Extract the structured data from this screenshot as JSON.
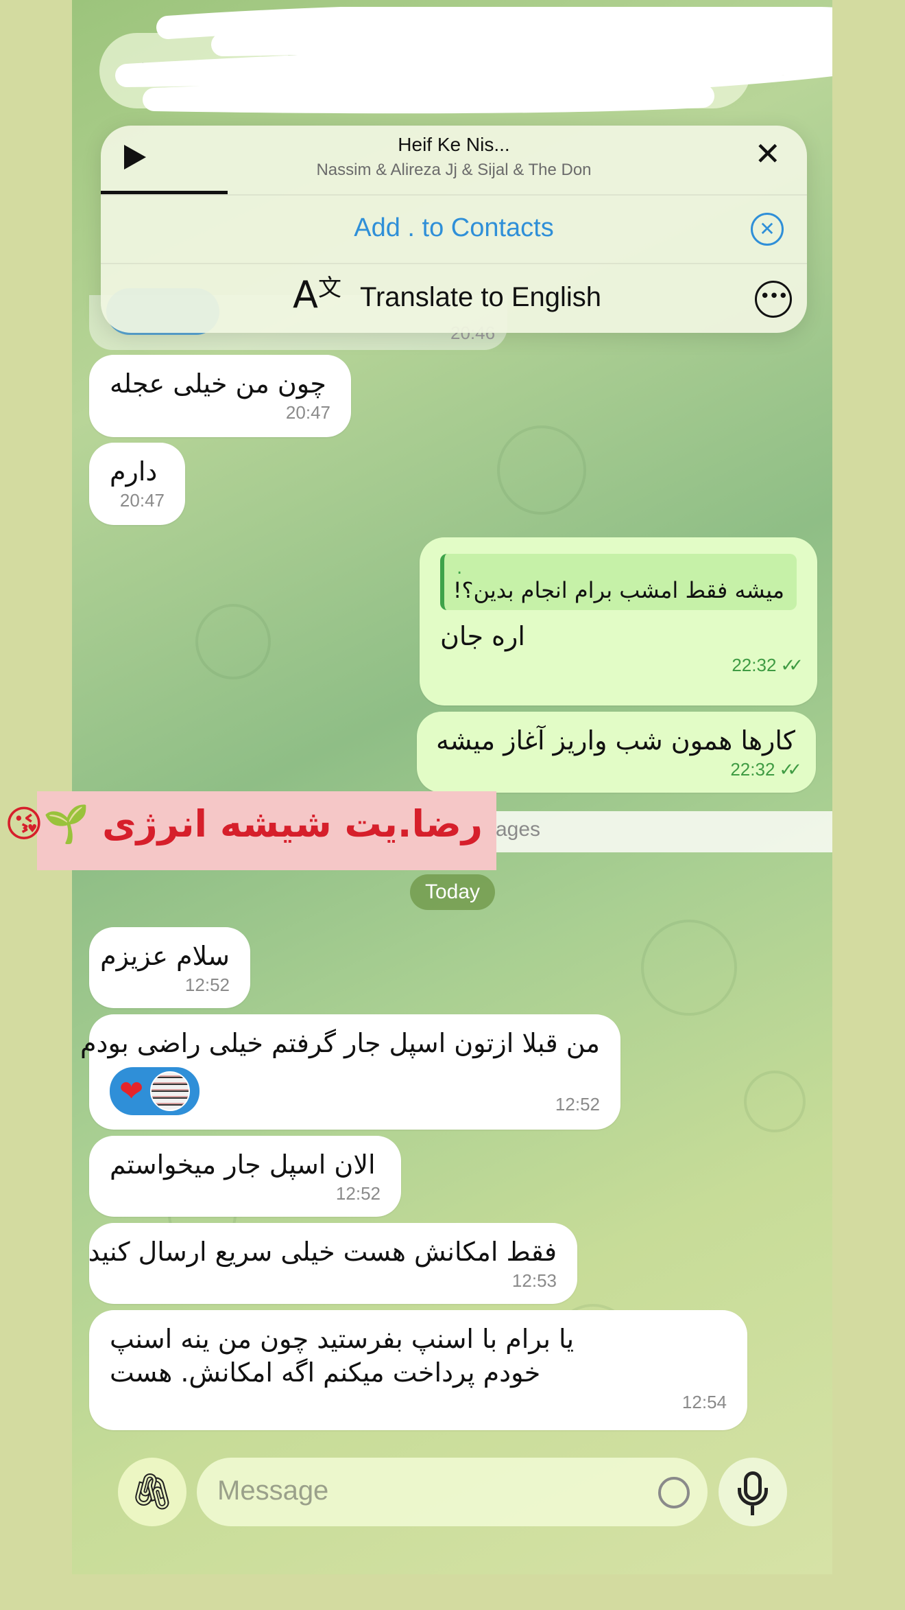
{
  "header": {
    "back_icon": "chevron-left-icon"
  },
  "player": {
    "title": "Heif Ke Nis...",
    "artist": "Nassim & Alireza Jj & Sijal & The Don",
    "progress": 0.18
  },
  "contact_banner": {
    "add_label": "Add . to Contacts"
  },
  "translate_banner": {
    "label": "Translate to English"
  },
  "hidden_message": {
    "time": "20:46"
  },
  "messages": [
    {
      "text": "چون من خیلی عجله",
      "time": "20:47"
    },
    {
      "text": "دارم",
      "time": "20:47"
    },
    {
      "reply_author": ".",
      "reply_text": "میشه فقط امشب برام انجام بدین؟!",
      "text": "اره جان",
      "time": "22:32"
    },
    {
      "text": "کارها همون شب واریز آغاز میشه",
      "time": "22:32"
    },
    {
      "text": "سلام عزیزم",
      "time": "12:52"
    },
    {
      "text": "من قبلا ازتون اسپل جار گرفتم خیلی راضی بودم",
      "time": "12:52",
      "reaction": "❤"
    },
    {
      "text": "الان اسپل جار میخواستم",
      "time": "12:52"
    },
    {
      "text": "فقط امکانش هست  خیلی سریع ارسال کنید",
      "time": "12:53"
    },
    {
      "text_line1": "یا برام با اسنپ بفرستید چون من          ینه  اسنپ",
      "text_line2": "خودم پرداخت میکنم اگه امکانش. هست",
      "time": "12:54"
    }
  ],
  "unread_bar": {
    "label": "ages"
  },
  "date_separator": {
    "label": "Today"
  },
  "sticker": {
    "text": "رضا.یت شیشه انرژی 🌱😘"
  },
  "composer": {
    "placeholder": "Message",
    "attach_icon": "paperclip-icon",
    "mic_icon": "microphone-icon"
  }
}
